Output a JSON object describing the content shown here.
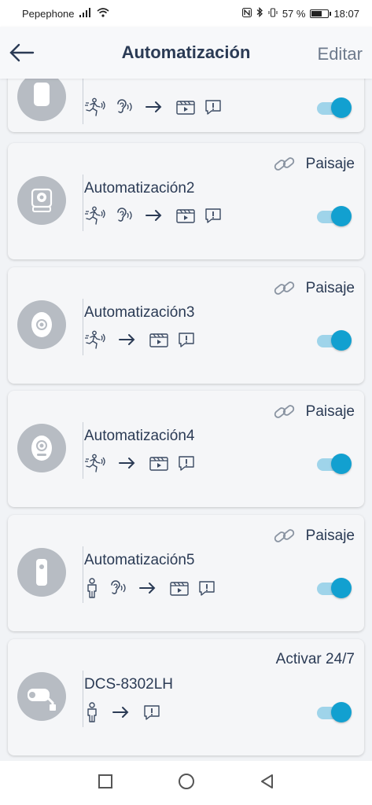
{
  "status_bar": {
    "carrier": "Pepephone",
    "battery": "57 %",
    "time": "18:07"
  },
  "header": {
    "title": "Automatización",
    "edit_label": "Editar",
    "back_icon": "arrow-left-icon"
  },
  "automations": [
    {
      "name": "",
      "tag": "",
      "triggers": [
        "motion",
        "sound"
      ],
      "actions": [
        "record",
        "notify"
      ],
      "enabled": true
    },
    {
      "name": "Automatización2",
      "tag": "Paisaje",
      "triggers": [
        "motion",
        "sound"
      ],
      "actions": [
        "record",
        "notify"
      ],
      "enabled": true
    },
    {
      "name": "Automatización3",
      "tag": "Paisaje",
      "triggers": [
        "motion"
      ],
      "actions": [
        "record",
        "notify"
      ],
      "enabled": true
    },
    {
      "name": "Automatización4",
      "tag": "Paisaje",
      "triggers": [
        "motion"
      ],
      "actions": [
        "record",
        "notify"
      ],
      "enabled": true
    },
    {
      "name": "Automatización5",
      "tag": "Paisaje",
      "triggers": [
        "person",
        "sound"
      ],
      "actions": [
        "record",
        "notify"
      ],
      "enabled": true
    },
    {
      "name": "DCS-8302LH",
      "tag": "Activar 24/7",
      "triggers": [
        "person"
      ],
      "actions": [
        "notify"
      ],
      "enabled": true
    }
  ],
  "colors": {
    "accent": "#12a0d0",
    "text": "#2b3b55",
    "card": "#f5f6f8"
  }
}
